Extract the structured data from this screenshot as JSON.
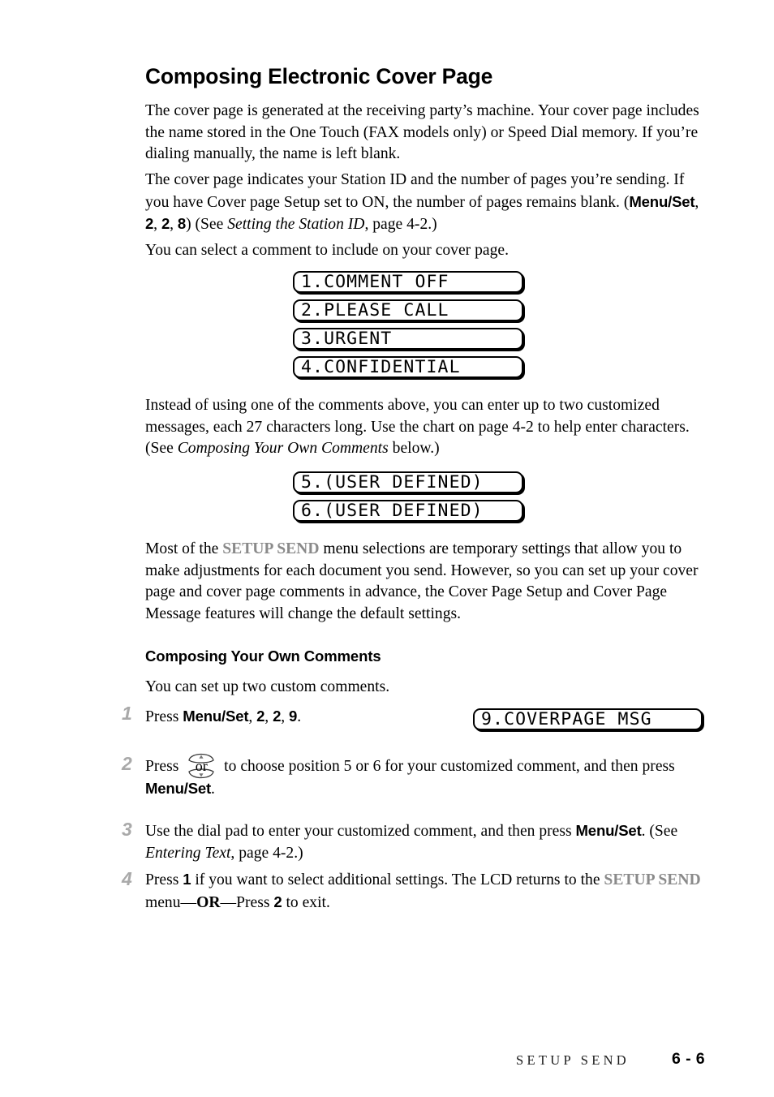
{
  "page": {
    "heading": "Composing Electronic Cover Page",
    "subheading": "Composing Your Own Comments"
  },
  "paragraphs": {
    "p1": "The cover page is generated at the receiving party’s machine. Your cover page includes the name stored in the One Touch (FAX models only) or Speed Dial memory. If you’re dialing manually, the name is left blank.",
    "p2_a": "The cover page indicates your Station ID and the number of pages you’re sending. If you have Cover page Setup set to ON, the number of pages remains blank.  (",
    "p2_menuset": "Menu/Set",
    "p2_comma1": ", ",
    "p2_key1": "2",
    "p2_comma2": ", ",
    "p2_key2": "2",
    "p2_comma3": ", ",
    "p2_key3": "8",
    "p2_b": ") (See ",
    "p2_italic": "Setting the Station ID",
    "p2_c": ", page 4-2.)",
    "p3": "You can select a comment to include on your cover page.",
    "p4_a": "Instead of using one of the comments above, you can enter up to two customized messages, each 27 characters long. Use the chart on page 4-2 to help enter characters. (See ",
    "p4_italic": "Composing Your Own Comments",
    "p4_b": " below.)",
    "p5_a": "Most of the ",
    "p5_setupsend": "SETUP SEND",
    "p5_b": " menu selections are temporary settings that allow you to make adjustments for each document you send. However, so you can set up your cover page and cover page comments in advance, the Cover Page Setup and Cover Page Message features will change the default settings.",
    "p6": "You can set up two custom comments."
  },
  "lcd_screens": [
    {
      "id": "comment-off",
      "text": "1.COMMENT OFF"
    },
    {
      "id": "please-call",
      "text": "2.PLEASE CALL"
    },
    {
      "id": "urgent",
      "text": "3.URGENT"
    },
    {
      "id": "confidential",
      "text": "4.CONFIDENTIAL"
    },
    {
      "id": "user-defined-5",
      "text": "5.(USER DEFINED)"
    },
    {
      "id": "user-defined-6",
      "text": "6.(USER DEFINED)"
    },
    {
      "id": "coverpage-msg",
      "text": "9.COVERPAGE MSG"
    }
  ],
  "steps": [
    {
      "number": "1",
      "a": "Press ",
      "menuset": "Menu/Set",
      "c1": ", ",
      "k1": "2",
      "c2": ", ",
      "k2": "2",
      "c3": ", ",
      "k3": "9",
      "end": "."
    },
    {
      "number": "2",
      "a": "Press ",
      "or_label": "or",
      "b": " to choose position 5 or 6 for your customized comment, and then press ",
      "menuset": "Menu/Set",
      "end": "."
    },
    {
      "number": "3",
      "a": "Use the dial pad to enter your customized comment, and then press ",
      "menuset": "Menu/Set",
      "b": ". (See ",
      "italic": "Entering Text",
      "c": ", page 4-2.)"
    },
    {
      "number": "4",
      "a": "Press ",
      "k1": "1",
      "b": " if you want to select additional settings. The LCD returns to the ",
      "setupsend": "SETUP SEND",
      "c": " menu—",
      "or": "OR",
      "d": "—Press ",
      "k2": "2",
      "e": " to exit."
    }
  ],
  "footer": {
    "chapter": "SETUP SEND",
    "page_number": "6 - 6"
  },
  "colors": {
    "text": "#000000",
    "gray_emphasis": "#8a8a8a",
    "step_number": "#a9a9a9",
    "lcd_border": "#000000",
    "background": "#ffffff"
  }
}
